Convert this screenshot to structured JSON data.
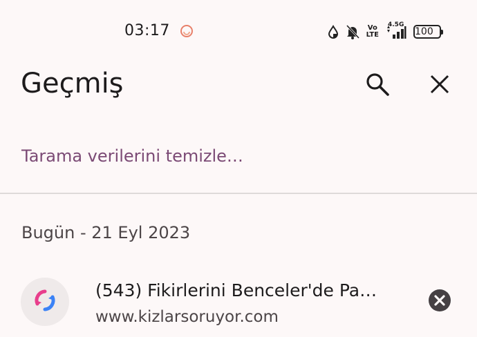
{
  "status_bar": {
    "time": "03:17",
    "network_label": "4.5G",
    "volte_label_top": "Vo",
    "volte_label_bottom": "LTE",
    "battery": "100",
    "icons": [
      "clock-app-icon",
      "data-saver-icon",
      "bell-off-icon",
      "volte-icon",
      "signal-icon",
      "battery-icon"
    ]
  },
  "header": {
    "title": "Geçmiş",
    "search_icon": "search-icon",
    "close_icon": "close-icon"
  },
  "clear_data_label": "Tarama verilerini temizle…",
  "history": {
    "date_label": "Bugün - 21 Eyl 2023",
    "items": [
      {
        "title": "(543) Fikirlerini Benceler'de Pa…",
        "url": "www.kizlarsoruyor.com",
        "favicon": "kizlarsoruyor-logo-icon",
        "remove_icon": "remove-circle-icon"
      }
    ]
  },
  "colors": {
    "background": "#fdf8f8",
    "accent": "#7b4a75",
    "text_primary": "#1d1b1c",
    "text_secondary": "#4c4547"
  }
}
